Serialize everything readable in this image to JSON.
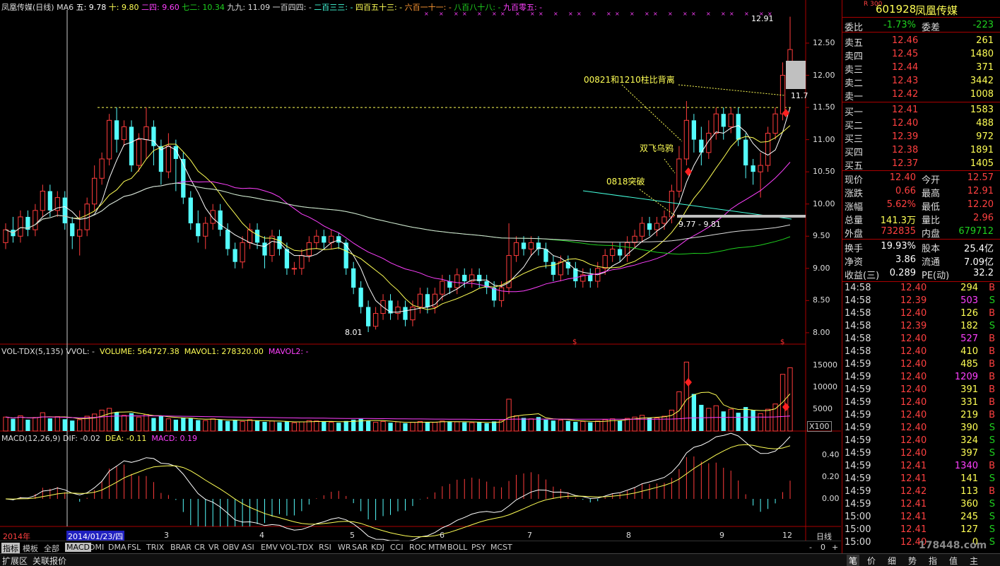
{
  "header": {
    "stock_name": "凤凰传媒(日线)",
    "ma_label": "MA6",
    "ma_items": [
      {
        "name": "五:",
        "value": "9.78",
        "color": "#ffffff"
      },
      {
        "name": "十:",
        "value": "9.80",
        "color": "#ffff55"
      },
      {
        "name": "二四:",
        "value": "9.60",
        "color": "#ff40ff"
      },
      {
        "name": "七二:",
        "value": "10.34",
        "color": "#1fd21f"
      },
      {
        "name": "九九:",
        "value": "11.09",
        "color": "#dddddd"
      },
      {
        "name": "一百四四:",
        "value": "-",
        "color": "#dddddd"
      },
      {
        "name": "二百三三:",
        "value": "-",
        "color": "#4fd"
      },
      {
        "name": "四百五十三:",
        "value": "-",
        "color": "#ffff55"
      },
      {
        "name": "六百一十一:",
        "value": "-",
        "color": "#ff9933"
      },
      {
        "name": "八百八十八:",
        "value": "-",
        "color": "#1fd21f"
      },
      {
        "name": "九百零五:",
        "value": "-",
        "color": "#ff40ff"
      }
    ]
  },
  "price_axis": [
    "12.50",
    "12.00",
    "11.50",
    "11.00",
    "10.50",
    "10.00",
    "9.50",
    "9.00",
    "8.50",
    "8.00"
  ],
  "annotations": {
    "high_label": "12.91",
    "low_label": "8.01",
    "mid_label": "11.7",
    "range_label": "9.77 - 9.81",
    "div_label": "00821和1210柱比背离",
    "crow_label": "双飞乌鸦",
    "break_label": "0818突破"
  },
  "volume": {
    "header": {
      "name": "VOL-TDX(5,135)",
      "vvol": "VVOL: -",
      "volume": "VOLUME: 564727.38",
      "mavol1": "MAVOL1: 278320.00",
      "mavol2": "MAVOL2: -"
    },
    "axis": [
      "15000",
      "10000",
      "5000"
    ],
    "unit": "X100"
  },
  "macd": {
    "header": {
      "name": "MACD(12,26,9)",
      "dif": "DIF: -0.02",
      "dea": "DEA: -0.11",
      "macd": "MACD: 0.19"
    },
    "axis": [
      "0.40",
      "0.20",
      "0.00"
    ]
  },
  "x_axis": {
    "year_label": "2014年",
    "cursor_date": "2014/01/23/四",
    "months": [
      "3",
      "4",
      "5",
      "6",
      "7",
      "8",
      "9",
      "12"
    ],
    "period": "日线"
  },
  "quote": {
    "code": "601928",
    "name": "凤凰传媒",
    "badge": "R 300",
    "weibi_label": "委比",
    "weibi": "-1.73%",
    "weicha_label": "委差",
    "weicha": "-223",
    "asks": [
      {
        "label": "卖五",
        "price": "12.46",
        "vol": "261"
      },
      {
        "label": "卖四",
        "price": "12.45",
        "vol": "1480"
      },
      {
        "label": "卖三",
        "price": "12.44",
        "vol": "371"
      },
      {
        "label": "卖二",
        "price": "12.43",
        "vol": "3442"
      },
      {
        "label": "卖一",
        "price": "12.42",
        "vol": "1008"
      }
    ],
    "bids": [
      {
        "label": "买一",
        "price": "12.41",
        "vol": "1583"
      },
      {
        "label": "买二",
        "price": "12.40",
        "vol": "488"
      },
      {
        "label": "买三",
        "price": "12.39",
        "vol": "972"
      },
      {
        "label": "买四",
        "price": "12.38",
        "vol": "1891"
      },
      {
        "label": "买五",
        "price": "12.37",
        "vol": "1405"
      }
    ],
    "stats": [
      {
        "l1": "现价",
        "v1": "12.40",
        "c1": "red",
        "l2": "今开",
        "v2": "12.57",
        "c2": "red"
      },
      {
        "l1": "涨跌",
        "v1": "0.66",
        "c1": "red",
        "l2": "最高",
        "v2": "12.91",
        "c2": "red"
      },
      {
        "l1": "涨幅",
        "v1": "5.62%",
        "c1": "red",
        "l2": "最低",
        "v2": "12.20",
        "c2": "red"
      },
      {
        "l1": "总量",
        "v1": "141.3万",
        "c1": "yel",
        "l2": "量比",
        "v2": "2.96",
        "c2": "red"
      },
      {
        "l1": "外盘",
        "v1": "732835",
        "c1": "red",
        "l2": "内盘",
        "v2": "679712",
        "c2": "green"
      }
    ],
    "stats2": [
      {
        "l1": "换手",
        "v1": "19.93%",
        "l2": "股本",
        "v2": "25.4亿"
      },
      {
        "l1": "净资",
        "v1": "3.86",
        "l2": "流通",
        "v2": "7.09亿"
      },
      {
        "l1": "收益(三)",
        "v1": "0.289",
        "l2": "PE(动)",
        "v2": "32.2"
      }
    ]
  },
  "ticks": [
    {
      "t": "14:58",
      "p": "12.40",
      "v": "294",
      "s": "B"
    },
    {
      "t": "14:58",
      "p": "12.39",
      "v": "503",
      "s": "S"
    },
    {
      "t": "14:58",
      "p": "12.40",
      "v": "126",
      "s": "B"
    },
    {
      "t": "14:58",
      "p": "12.39",
      "v": "182",
      "s": "S"
    },
    {
      "t": "14:58",
      "p": "12.40",
      "v": "527",
      "s": "B"
    },
    {
      "t": "14:58",
      "p": "12.40",
      "v": "410",
      "s": "B"
    },
    {
      "t": "14:59",
      "p": "12.40",
      "v": "485",
      "s": "B"
    },
    {
      "t": "14:59",
      "p": "12.40",
      "v": "1209",
      "s": "B"
    },
    {
      "t": "14:59",
      "p": "12.40",
      "v": "391",
      "s": "B"
    },
    {
      "t": "14:59",
      "p": "12.40",
      "v": "331",
      "s": "B"
    },
    {
      "t": "14:59",
      "p": "12.40",
      "v": "219",
      "s": "B"
    },
    {
      "t": "14:59",
      "p": "12.40",
      "v": "390",
      "s": "S"
    },
    {
      "t": "14:59",
      "p": "12.40",
      "v": "324",
      "s": "S"
    },
    {
      "t": "14:59",
      "p": "12.40",
      "v": "397",
      "s": "S"
    },
    {
      "t": "14:59",
      "p": "12.41",
      "v": "1340",
      "s": "B"
    },
    {
      "t": "14:59",
      "p": "12.41",
      "v": "141",
      "s": "S"
    },
    {
      "t": "14:59",
      "p": "12.42",
      "v": "113",
      "s": "B"
    },
    {
      "t": "14:59",
      "p": "12.41",
      "v": "360",
      "s": "S"
    },
    {
      "t": "15:00",
      "p": "12.41",
      "v": "245",
      "s": "S"
    },
    {
      "t": "15:00",
      "p": "12.41",
      "v": "127",
      "s": "S"
    },
    {
      "t": "15:00",
      "p": "12.40",
      "v": "0",
      "s": "S"
    }
  ],
  "indicator_tabs": [
    "指标",
    "模板",
    "全部",
    "MACD",
    "DMI",
    "DMA",
    "FSL",
    "TRIX",
    "BRAR",
    "CR",
    "VR",
    "OBV",
    "ASI",
    "EMV",
    "VOL-TDX",
    "RSI",
    "WR",
    "SAR",
    "KDJ",
    "CCI",
    "ROC",
    "MTM",
    "BOLL",
    "PSY",
    "MCST"
  ],
  "status_left": [
    "扩展区",
    "关联报价"
  ],
  "status_right": [
    "笔",
    "价",
    "细",
    "势",
    "指",
    "值",
    "主"
  ],
  "watermark": "178448.com",
  "page_controls": [
    "-",
    "0",
    "+"
  ],
  "chart_data": {
    "type": "candlestick",
    "title": "凤凰传媒(日线)",
    "price_range": [
      7.9,
      12.95
    ],
    "high": 12.91,
    "low": 8.01,
    "resistance": 11.5,
    "candles": [
      [
        9.4,
        9.6,
        9.3,
        9.7
      ],
      [
        9.6,
        9.5,
        9.4,
        9.8
      ],
      [
        9.5,
        9.8,
        9.4,
        9.9
      ],
      [
        9.8,
        9.6,
        9.5,
        9.9
      ],
      [
        9.6,
        9.9,
        9.5,
        10.0
      ],
      [
        9.9,
        10.2,
        9.8,
        10.3
      ],
      [
        10.2,
        9.9,
        9.8,
        10.3
      ],
      [
        9.9,
        10.1,
        9.8,
        10.2
      ],
      [
        10.1,
        9.7,
        9.6,
        10.2
      ],
      [
        9.7,
        9.5,
        9.3,
        9.8
      ],
      [
        9.5,
        9.6,
        9.2,
        9.9
      ],
      [
        9.6,
        10.0,
        9.5,
        10.1
      ],
      [
        10.0,
        10.4,
        9.9,
        10.6
      ],
      [
        10.4,
        10.7,
        10.3,
        10.8
      ],
      [
        10.7,
        11.3,
        10.6,
        11.4
      ],
      [
        11.3,
        11.0,
        10.8,
        11.5
      ],
      [
        11.0,
        11.2,
        10.9,
        11.3
      ],
      [
        11.2,
        10.6,
        10.5,
        11.3
      ],
      [
        10.6,
        11.0,
        10.5,
        11.1
      ],
      [
        11.0,
        11.2,
        10.7,
        11.5
      ],
      [
        11.2,
        10.9,
        10.6,
        11.3
      ],
      [
        10.9,
        10.5,
        10.3,
        11.0
      ],
      [
        10.5,
        10.9,
        10.4,
        11.1
      ],
      [
        10.9,
        10.7,
        10.2,
        11.0
      ],
      [
        10.7,
        10.1,
        10.0,
        10.8
      ],
      [
        10.1,
        9.7,
        9.6,
        10.2
      ],
      [
        9.7,
        9.5,
        9.4,
        9.9
      ],
      [
        9.5,
        9.7,
        9.3,
        9.8
      ],
      [
        9.7,
        9.9,
        9.6,
        10.0
      ],
      [
        9.9,
        9.6,
        9.5,
        10.0
      ],
      [
        9.6,
        9.3,
        9.2,
        9.7
      ],
      [
        9.3,
        9.1,
        9.0,
        9.4
      ],
      [
        9.1,
        9.4,
        9.0,
        9.5
      ],
      [
        9.4,
        9.6,
        9.3,
        9.7
      ],
      [
        9.6,
        9.4,
        9.3,
        9.7
      ],
      [
        9.4,
        9.2,
        9.0,
        9.5
      ],
      [
        9.2,
        9.5,
        9.1,
        9.6
      ],
      [
        9.5,
        9.3,
        9.2,
        9.6
      ],
      [
        9.3,
        9.0,
        8.9,
        9.4
      ],
      [
        9.0,
        9.0,
        8.9,
        9.1
      ],
      [
        9.0,
        9.2,
        8.9,
        9.3
      ],
      [
        9.2,
        9.4,
        9.1,
        9.5
      ],
      [
        9.4,
        9.5,
        9.3,
        9.6
      ],
      [
        9.5,
        9.4,
        9.3,
        9.6
      ],
      [
        9.4,
        9.5,
        9.3,
        9.6
      ],
      [
        9.5,
        9.4,
        9.3,
        9.55
      ],
      [
        9.4,
        9.0,
        8.9,
        9.45
      ],
      [
        9.0,
        8.7,
        8.6,
        9.1
      ],
      [
        8.7,
        8.4,
        8.3,
        8.8
      ],
      [
        8.4,
        8.1,
        8.01,
        8.5
      ],
      [
        8.1,
        8.3,
        8.05,
        8.4
      ],
      [
        8.3,
        8.5,
        8.2,
        8.6
      ],
      [
        8.5,
        8.3,
        8.2,
        8.6
      ],
      [
        8.3,
        8.4,
        8.2,
        8.5
      ],
      [
        8.4,
        8.2,
        8.1,
        8.5
      ],
      [
        8.2,
        8.4,
        8.1,
        8.5
      ],
      [
        8.4,
        8.6,
        8.3,
        8.7
      ],
      [
        8.6,
        8.4,
        8.3,
        8.7
      ],
      [
        8.4,
        8.6,
        8.3,
        8.7
      ],
      [
        8.6,
        8.8,
        8.5,
        8.9
      ],
      [
        8.8,
        8.7,
        8.6,
        8.9
      ],
      [
        8.7,
        8.9,
        8.6,
        9.0
      ],
      [
        8.9,
        8.8,
        8.7,
        9.0
      ],
      [
        8.8,
        8.9,
        8.7,
        9.0
      ],
      [
        8.9,
        8.8,
        8.7,
        9.0
      ],
      [
        8.8,
        8.7,
        8.6,
        8.9
      ],
      [
        8.7,
        8.5,
        8.4,
        8.8
      ],
      [
        8.5,
        8.7,
        8.4,
        8.8
      ],
      [
        8.7,
        9.2,
        8.6,
        9.7
      ],
      [
        9.2,
        9.4,
        9.1,
        9.5
      ],
      [
        9.4,
        9.3,
        9.2,
        9.5
      ],
      [
        9.3,
        9.4,
        9.2,
        9.5
      ],
      [
        9.4,
        9.3,
        9.2,
        9.5
      ],
      [
        9.3,
        9.1,
        9.0,
        9.4
      ],
      [
        9.1,
        8.9,
        8.8,
        9.2
      ],
      [
        8.9,
        9.1,
        8.8,
        9.2
      ],
      [
        9.1,
        9.0,
        8.9,
        9.2
      ],
      [
        9.0,
        8.8,
        8.7,
        9.1
      ],
      [
        8.8,
        8.9,
        8.7,
        9.0
      ],
      [
        8.9,
        8.8,
        8.7,
        9.0
      ],
      [
        8.8,
        9.0,
        8.7,
        9.1
      ],
      [
        9.0,
        9.2,
        8.9,
        9.3
      ],
      [
        9.2,
        9.3,
        9.1,
        9.4
      ],
      [
        9.3,
        9.2,
        9.1,
        9.4
      ],
      [
        9.2,
        9.4,
        9.1,
        9.5
      ],
      [
        9.4,
        9.5,
        9.3,
        9.6
      ],
      [
        9.5,
        9.7,
        9.4,
        9.8
      ],
      [
        9.7,
        9.6,
        9.5,
        9.8
      ],
      [
        9.6,
        9.7,
        9.5,
        9.8
      ],
      [
        9.7,
        9.8,
        9.6,
        9.9
      ],
      [
        9.8,
        10.2,
        9.7,
        10.3
      ],
      [
        10.2,
        10.7,
        10.1,
        10.9
      ],
      [
        10.7,
        11.3,
        10.6,
        11.6
      ],
      [
        11.3,
        11.0,
        10.8,
        11.4
      ],
      [
        11.0,
        10.8,
        10.6,
        11.2
      ],
      [
        10.8,
        11.1,
        10.7,
        11.3
      ],
      [
        11.1,
        11.4,
        11.0,
        11.5
      ],
      [
        11.4,
        11.2,
        11.0,
        11.5
      ],
      [
        11.2,
        11.4,
        11.1,
        11.5
      ],
      [
        11.4,
        11.0,
        10.9,
        11.5
      ],
      [
        11.0,
        10.6,
        10.4,
        11.1
      ],
      [
        10.6,
        10.5,
        10.3,
        10.7
      ],
      [
        10.5,
        10.6,
        10.1,
        10.8
      ],
      [
        10.6,
        11.1,
        10.5,
        11.2
      ],
      [
        11.1,
        11.4,
        11.0,
        11.5
      ],
      [
        11.4,
        12.0,
        11.3,
        12.2
      ],
      [
        12.0,
        12.4,
        11.9,
        12.91
      ]
    ],
    "volume": [
      3200,
      2800,
      3500,
      2600,
      3100,
      4200,
      2900,
      3300,
      2700,
      2400,
      2600,
      3400,
      3900,
      4800,
      5200,
      4300,
      3600,
      4100,
      3200,
      3800,
      3000,
      3500,
      2800,
      2600,
      3100,
      2900,
      2500,
      2400,
      2800,
      2600,
      2300,
      2500,
      2200,
      2600,
      2400,
      2100,
      2300,
      2000,
      2200,
      1900,
      2100,
      2400,
      2300,
      2200,
      2000,
      1900,
      2300,
      2600,
      2800,
      2400,
      2000,
      2200,
      1900,
      2100,
      1800,
      2000,
      2200,
      2100,
      2000,
      2300,
      2200,
      2100,
      2000,
      1900,
      2000,
      1800,
      2200,
      2400,
      7300,
      3500,
      3000,
      2800,
      3200,
      2600,
      2400,
      2500,
      2300,
      2100,
      2200,
      2000,
      2300,
      2600,
      2800,
      2400,
      2900,
      3200,
      3600,
      3100,
      3000,
      3400,
      4800,
      9000,
      15800,
      8500,
      6000,
      5200,
      5800,
      4500,
      5000,
      4200,
      5500,
      4800,
      4000,
      5000,
      6200,
      13000,
      14500
    ],
    "macd_range": [
      -0.25,
      0.5
    ]
  }
}
